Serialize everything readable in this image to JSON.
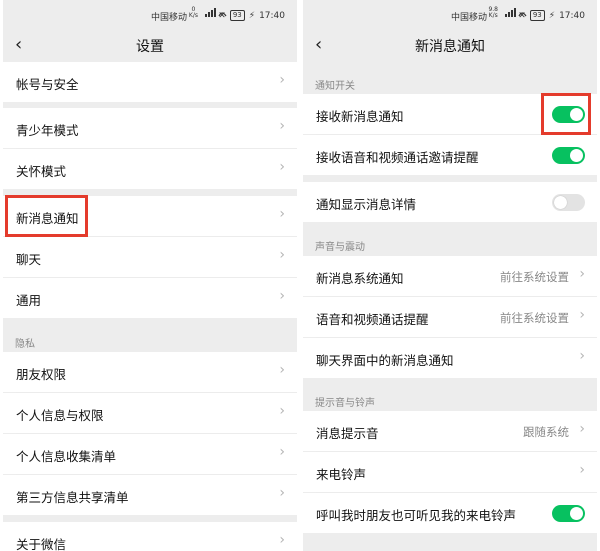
{
  "status_bar": {
    "carrier": "中国移动",
    "left_speed_value": "0",
    "left_speed_unit": "K/s",
    "right_speed_value": "9.8",
    "right_speed_unit": "K/s",
    "battery": "93",
    "time": "17:40"
  },
  "settings": {
    "title": "设置",
    "items_group1": [
      "帐号与安全"
    ],
    "items_group2": [
      "青少年模式",
      "关怀模式"
    ],
    "items_group3": [
      "新消息通知",
      "聊天",
      "通用"
    ],
    "section_privacy": "隐私",
    "items_privacy": [
      "朋友权限",
      "个人信息与权限",
      "个人信息收集清单",
      "第三方信息共享清单"
    ],
    "items_about": [
      "关于微信"
    ]
  },
  "notifications": {
    "title": "新消息通知",
    "section_switch": "通知开关",
    "receive_new": {
      "label": "接收新消息通知",
      "on": true
    },
    "receive_call": {
      "label": "接收语音和视频通话邀请提醒",
      "on": true
    },
    "show_detail": {
      "label": "通知显示消息详情",
      "on": false
    },
    "section_sound": "声音与震动",
    "system_notify": {
      "label": "新消息系统通知",
      "value": "前往系统设置"
    },
    "call_reminder": {
      "label": "语音和视频通话提醒",
      "value": "前往系统设置"
    },
    "chat_notify": {
      "label": "聊天界面中的新消息通知"
    },
    "section_ring": "提示音与铃声",
    "tone": {
      "label": "消息提示音",
      "value": "跟随系统"
    },
    "ringtone": {
      "label": "来电铃声"
    },
    "ringtone_share": {
      "label": "呼叫我时朋友也可听见我的来电铃声",
      "on": true
    }
  },
  "colors": {
    "accent_green": "#07c160",
    "highlight_red": "#e43b2c",
    "background": "#ededed"
  }
}
